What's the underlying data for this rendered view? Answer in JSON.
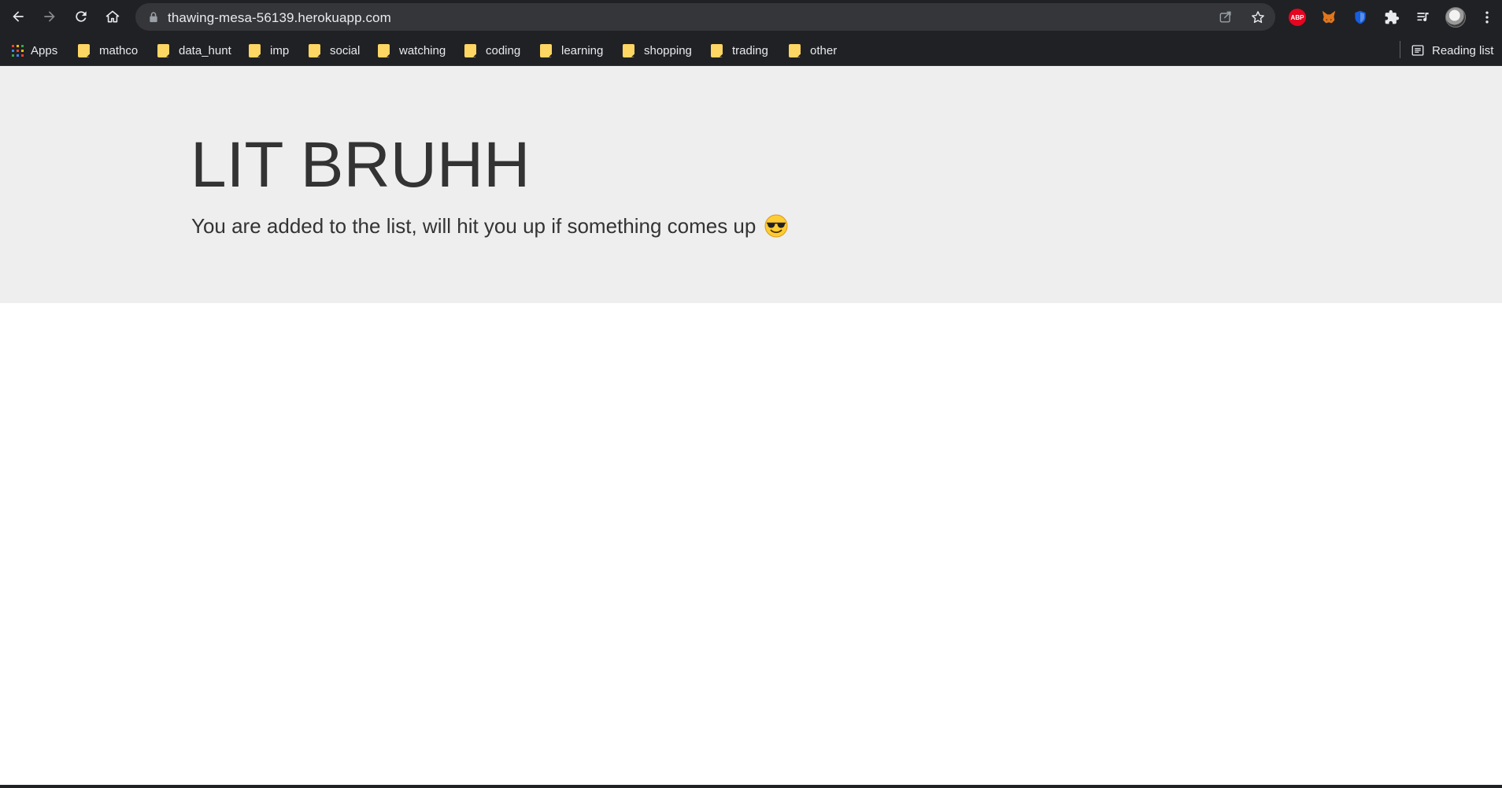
{
  "browser": {
    "url": "thawing-mesa-56139.herokuapp.com",
    "extensions": [
      "adblock-plus-icon",
      "metamask-icon",
      "bitwarden-icon",
      "extensions-puzzle-icon",
      "media-control-icon"
    ],
    "abp_label": "ABP"
  },
  "bookmarks": {
    "apps_label": "Apps",
    "items": [
      {
        "label": "mathco"
      },
      {
        "label": "data_hunt"
      },
      {
        "label": "imp"
      },
      {
        "label": "social"
      },
      {
        "label": "watching"
      },
      {
        "label": "coding"
      },
      {
        "label": "learning"
      },
      {
        "label": "shopping"
      },
      {
        "label": "trading"
      },
      {
        "label": "other"
      }
    ],
    "reading_list_label": "Reading list"
  },
  "page": {
    "title": "LIT BRUHH",
    "lead": "You are added to the list, will hit you up if something comes up",
    "emoji": "smiling-face-with-sunglasses-icon"
  },
  "colors": {
    "chrome_bg": "#202124",
    "omnibox_bg": "#35363a",
    "jumbotron_bg": "#eeeeee",
    "text": "#333333",
    "folder": "#fdd663"
  }
}
